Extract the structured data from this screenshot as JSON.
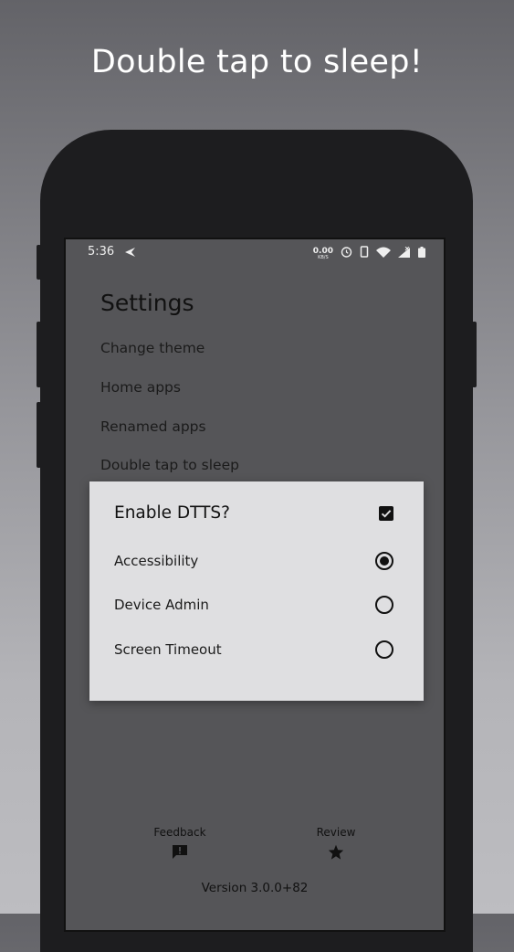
{
  "headline": "Double tap to sleep!",
  "status_bar": {
    "time": "5:36",
    "network_speed": "0.00",
    "network_unit": "KB/S",
    "icons": [
      "share-arrow-icon",
      "alarm-icon",
      "phone-vibrate-icon",
      "wifi-icon",
      "signal-icon",
      "battery-icon"
    ]
  },
  "settings": {
    "title": "Settings",
    "items": [
      {
        "label": "Change theme"
      },
      {
        "label": "Home apps"
      },
      {
        "label": "Renamed apps"
      },
      {
        "label": "Double tap to sleep"
      }
    ]
  },
  "dialog": {
    "title": "Enable DTTS?",
    "enabled": true,
    "options": [
      {
        "label": "Accessibility",
        "selected": true
      },
      {
        "label": "Device Admin",
        "selected": false
      },
      {
        "label": "Screen Timeout",
        "selected": false
      }
    ]
  },
  "footer": {
    "feedback_label": "Feedback",
    "review_label": "Review",
    "version": "Version 3.0.0+82"
  }
}
